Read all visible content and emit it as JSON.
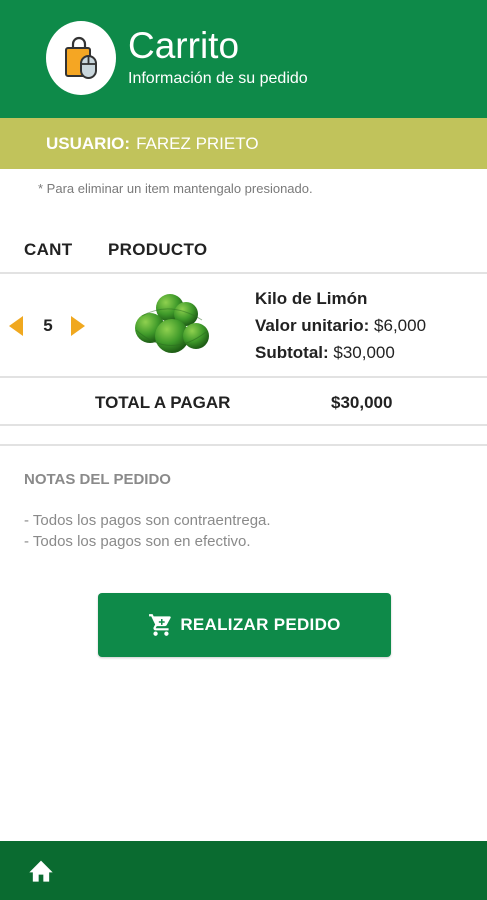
{
  "header": {
    "title": "Carrito",
    "subtitle": "Información de su pedido",
    "logo_icon": "shopping-bag-icon",
    "color": "#0e8a49"
  },
  "user": {
    "label": "USUARIO:",
    "name": "FAREZ PRIETO",
    "color": "#c1c35b"
  },
  "hint": "* Para eliminar un item mantengalo presionado.",
  "table": {
    "col_cant": "CANT",
    "col_producto": "PRODUCTO"
  },
  "item": {
    "quantity": "5",
    "name": "Kilo de Limón",
    "unit_label": "Valor unitario:",
    "unit_value": "$6,000",
    "subtotal_label": "Subtotal:",
    "subtotal_value": "$30,000",
    "image_icon": "limes-image",
    "decrease_icon": "arrow-left-icon",
    "increase_icon": "arrow-right-icon",
    "arrow_color": "#f0a81f"
  },
  "total": {
    "label": "TOTAL A PAGAR",
    "value": "$30,000"
  },
  "notes": {
    "title": "NOTAS DEL PEDIDO",
    "lines": [
      "- Todos los pagos son contraentrega.",
      "- Todos los pagos son en efectivo."
    ]
  },
  "order_button": {
    "label": "REALIZAR PEDIDO",
    "icon": "cart-icon"
  },
  "bottom_nav": {
    "home_icon": "home-icon",
    "color": "#0a6b30"
  }
}
